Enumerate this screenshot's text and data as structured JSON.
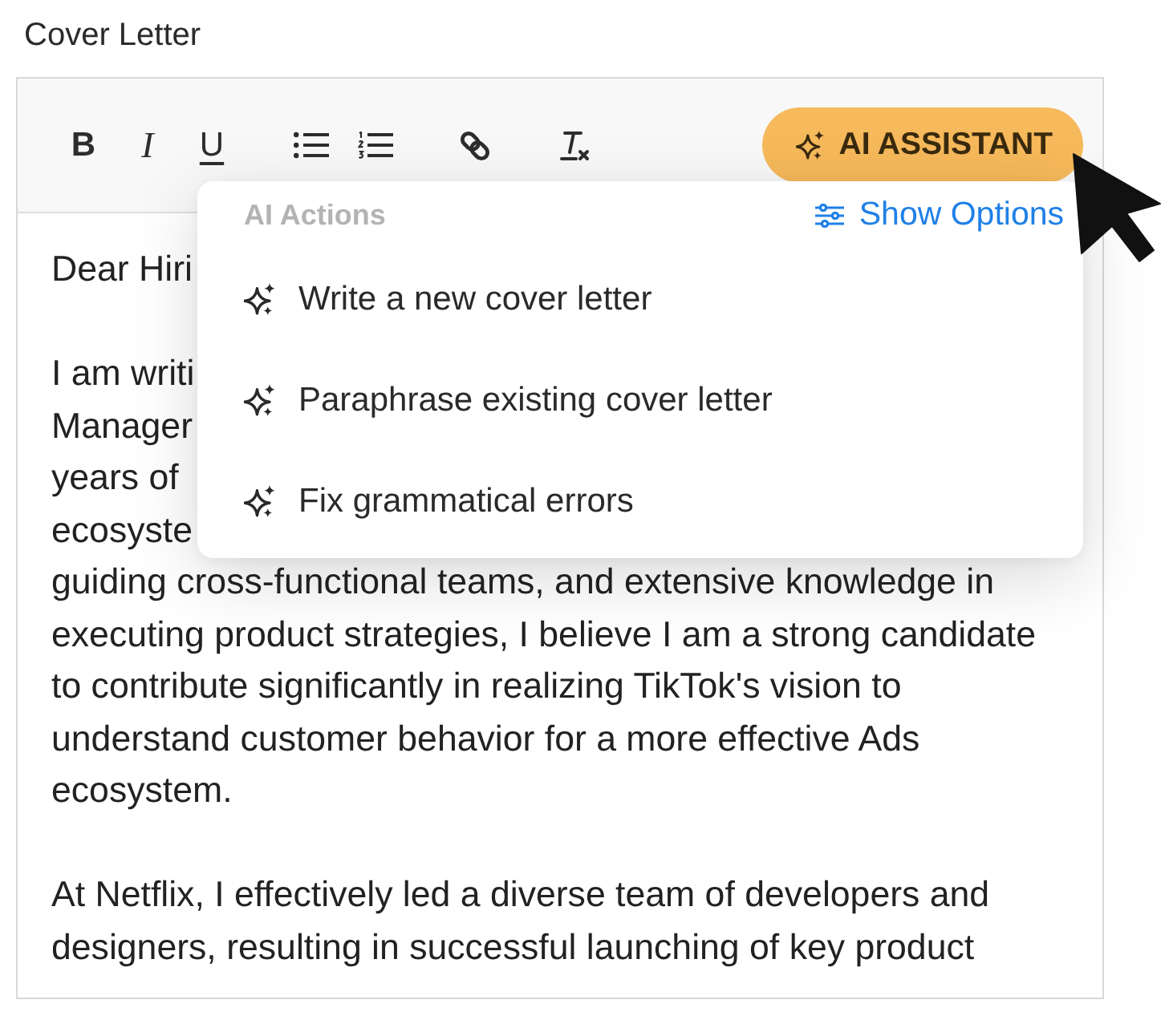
{
  "field": {
    "label": "Cover Letter"
  },
  "toolbar": {
    "groups": [
      {
        "tools": [
          {
            "kind": "bold",
            "label": "B"
          },
          {
            "kind": "italic",
            "label": "I"
          },
          {
            "kind": "underline",
            "label": "U"
          }
        ]
      },
      {
        "tools": [
          {
            "kind": "bullets"
          },
          {
            "kind": "numbering"
          }
        ]
      },
      {
        "tools": [
          {
            "kind": "link"
          }
        ]
      },
      {
        "tools": [
          {
            "kind": "clear"
          }
        ]
      }
    ]
  },
  "ai_button": {
    "label": "AI ASSISTANT"
  },
  "ai_menu": {
    "heading": "AI Actions",
    "options_link": "Show Options",
    "items": [
      {
        "label": "Write a new cover letter"
      },
      {
        "label": "Paraphrase existing cover letter"
      },
      {
        "label": "Fix grammatical errors"
      }
    ]
  },
  "letter": {
    "paragraphs": [
      {
        "lines": [
          "Dear Hiri"
        ]
      },
      {
        "lines": [
          "I am writi",
          "Manager",
          "years of",
          "ecosyste",
          "guiding cross-functional teams, and extensive knowledge in",
          "executing product strategies, I believe I am a strong candidate",
          "to contribute significantly in realizing TikTok's vision to",
          "understand customer behavior for a more effective Ads",
          "ecosystem."
        ]
      },
      {
        "lines": [
          "At Netflix, I effectively led a diverse team of developers and",
          "designers, resulting in successful launching of key product"
        ]
      }
    ]
  }
}
